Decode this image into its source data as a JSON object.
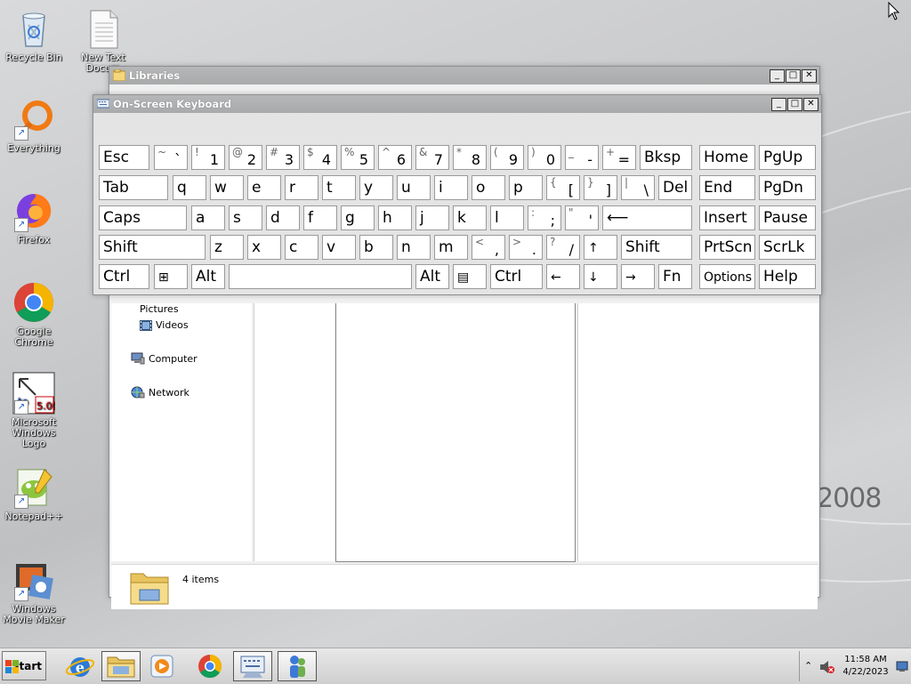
{
  "desktop": {
    "watermark": "2008",
    "icons": [
      {
        "label": "Recycle Bin",
        "icon": "recycle-bin-icon"
      },
      {
        "label": "New Text Docum",
        "icon": "text-document-icon"
      },
      {
        "label": "Everything",
        "icon": "everything-icon"
      },
      {
        "label": "Firefox",
        "icon": "firefox-icon"
      },
      {
        "label": "Google Chrome",
        "icon": "chrome-icon"
      },
      {
        "label": "Microsoft Windows Logo",
        "icon": "windows-logo-kit-icon"
      },
      {
        "label": "Notepad++",
        "icon": "notepadpp-icon"
      },
      {
        "label": "Windows Movie Maker",
        "icon": "movie-maker-icon"
      }
    ]
  },
  "explorer": {
    "title": "Libraries",
    "nav": {
      "pictures": "Pictures",
      "videos": "Videos",
      "computer": "Computer",
      "network": "Network"
    },
    "status": "4 items"
  },
  "osk": {
    "title": "On-Screen Keyboard",
    "rows": [
      [
        {
          "label": "Esc"
        },
        {
          "shift": "~",
          "main": "`"
        },
        {
          "shift": "!",
          "main": "1"
        },
        {
          "shift": "@",
          "main": "2"
        },
        {
          "shift": "#",
          "main": "3"
        },
        {
          "shift": "$",
          "main": "4"
        },
        {
          "shift": "%",
          "main": "5"
        },
        {
          "shift": "^",
          "main": "6"
        },
        {
          "shift": "&",
          "main": "7"
        },
        {
          "shift": "*",
          "main": "8"
        },
        {
          "shift": "(",
          "main": "9"
        },
        {
          "shift": ")",
          "main": "0"
        },
        {
          "shift": "_",
          "main": "-"
        },
        {
          "shift": "+",
          "main": "="
        },
        {
          "label": "Bksp"
        },
        {
          "label": "Home"
        },
        {
          "label": "PgUp"
        }
      ],
      [
        {
          "label": "Tab"
        },
        {
          "label": "q"
        },
        {
          "label": "w"
        },
        {
          "label": "e"
        },
        {
          "label": "r"
        },
        {
          "label": "t"
        },
        {
          "label": "y"
        },
        {
          "label": "u"
        },
        {
          "label": "i"
        },
        {
          "label": "o"
        },
        {
          "label": "p"
        },
        {
          "shift": "{",
          "main": "["
        },
        {
          "shift": "}",
          "main": "]"
        },
        {
          "shift": "|",
          "main": "\\"
        },
        {
          "label": "Del"
        },
        {
          "label": "End"
        },
        {
          "label": "PgDn"
        }
      ],
      [
        {
          "label": "Caps"
        },
        {
          "label": "a"
        },
        {
          "label": "s"
        },
        {
          "label": "d"
        },
        {
          "label": "f"
        },
        {
          "label": "g"
        },
        {
          "label": "h"
        },
        {
          "label": "j"
        },
        {
          "label": "k"
        },
        {
          "label": "l"
        },
        {
          "shift": ":",
          "main": ";"
        },
        {
          "shift": "\"",
          "main": "'"
        },
        {
          "label": "⟵"
        },
        {
          "label": "Insert"
        },
        {
          "label": "Pause"
        }
      ],
      [
        {
          "label": "Shift"
        },
        {
          "label": "z"
        },
        {
          "label": "x"
        },
        {
          "label": "c"
        },
        {
          "label": "v"
        },
        {
          "label": "b"
        },
        {
          "label": "n"
        },
        {
          "label": "m"
        },
        {
          "shift": "<",
          "main": ","
        },
        {
          "shift": ">",
          "main": "."
        },
        {
          "shift": "?",
          "main": "/"
        },
        {
          "label": "↑"
        },
        {
          "label": "Shift"
        },
        {
          "label": "PrtScn"
        },
        {
          "label": "ScrLk"
        }
      ],
      [
        {
          "label": "Ctrl"
        },
        {
          "label": "⊞"
        },
        {
          "label": "Alt"
        },
        {
          "label": ""
        },
        {
          "label": "Alt"
        },
        {
          "label": "▤"
        },
        {
          "label": "Ctrl"
        },
        {
          "label": "←"
        },
        {
          "label": "↓"
        },
        {
          "label": "→"
        },
        {
          "label": "Fn"
        },
        {
          "label": "Options"
        },
        {
          "label": "Help"
        }
      ]
    ]
  },
  "taskbar": {
    "start": "Start",
    "apps": [
      "internet-explorer-icon",
      "file-explorer-icon",
      "media-player-icon",
      "chrome-icon",
      "on-screen-keyboard-icon",
      "people-icon"
    ],
    "time": "11:58 AM",
    "date": "4/22/2023"
  }
}
